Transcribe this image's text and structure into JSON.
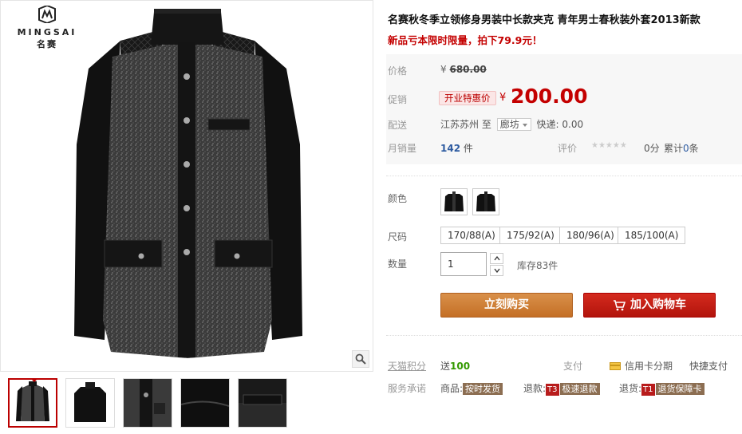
{
  "brand": {
    "name_en": "MINGSAI",
    "name_cn": "名赛"
  },
  "product": {
    "title": "名赛秋冬季立领修身男装中长款夹克 青年男士春秋装外套2013新款",
    "subtitle": "新品亏本限时限量，拍下79.9元！"
  },
  "price": {
    "label": "价格",
    "currency": "¥",
    "original": "680.00",
    "promo_label": "促销",
    "promo_badge": "开业特惠价",
    "promo_price": "200.00"
  },
  "shipping": {
    "label": "配送",
    "from": "江苏苏州",
    "to_word": "至",
    "destination": "廊坊",
    "fee": "快递: 0.00"
  },
  "sales": {
    "label": "月销量",
    "count": "142",
    "unit": "件",
    "rating_label": "评价",
    "score": "0分",
    "reviews_prefix": "累计",
    "reviews_count": "0",
    "reviews_unit": "条"
  },
  "options": {
    "color_label": "颜色",
    "size_label": "尺码",
    "sizes": [
      "170/88(A)",
      "175/92(A)",
      "180/96(A)",
      "185/100(A)"
    ],
    "qty_label": "数量",
    "qty_value": "1",
    "stock": "库存83件"
  },
  "actions": {
    "buy_now": "立刻购买",
    "add_to_cart": "加入购物车"
  },
  "extras": {
    "tmall_points": "天猫积分",
    "points_prefix": "送",
    "points_value": "100",
    "pay_label": "支付",
    "credit_pay": "信用卡分期",
    "fast_pay": "快捷支付",
    "service_label": "服务承诺",
    "goods_label": "商品:",
    "goods_tag": "按时发货",
    "refund_label": "退款:",
    "refund_t": "T3",
    "refund_tag": "极速退款",
    "return_label": "退货:",
    "return_t": "T1",
    "return_tag": "退货保障卡"
  },
  "colors": {
    "accent_red": "#c40000",
    "buy_orange": "#c46f25",
    "cart_red": "#b2140c"
  }
}
